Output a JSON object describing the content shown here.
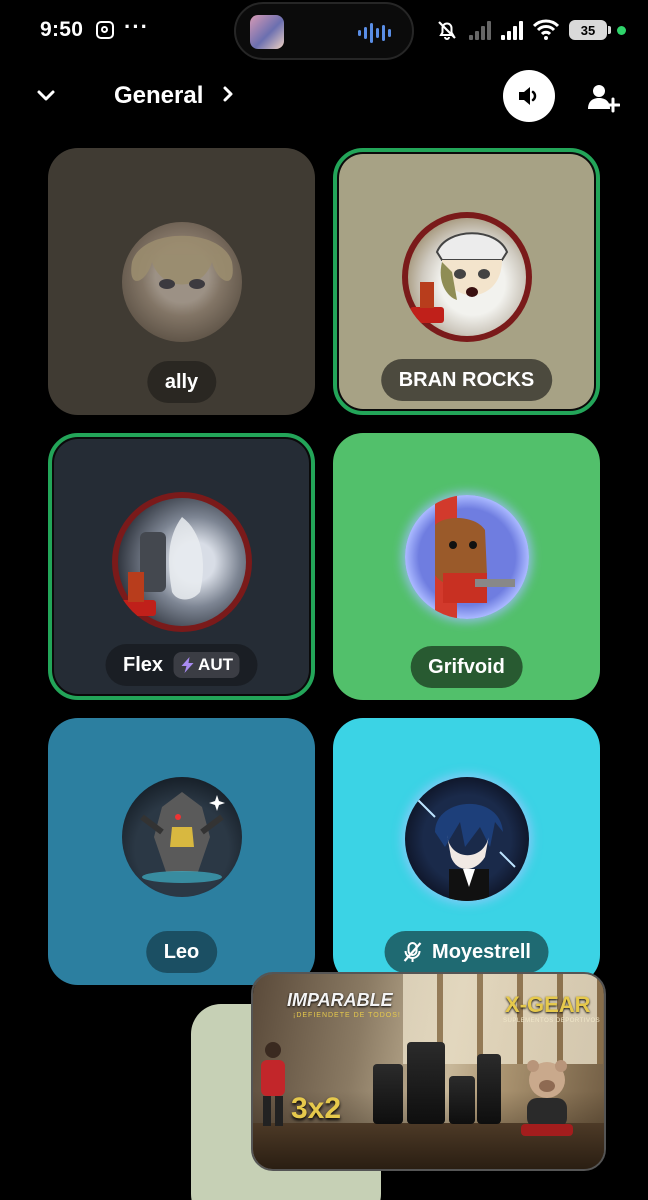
{
  "status_bar": {
    "time": "9:50",
    "overflow": "···",
    "battery": "35",
    "icons": [
      "instagram-icon",
      "audio-wave-icon",
      "muted-bell-icon",
      "signal-icon",
      "wifi-icon",
      "battery-icon"
    ]
  },
  "header": {
    "title": "General",
    "icons": [
      "chevron-down-icon",
      "chevron-right-icon",
      "speaker-icon",
      "add-user-icon"
    ]
  },
  "participants": [
    {
      "name": "ally",
      "speaking": false,
      "tile_color": "#403b33",
      "pill_color": "#2a2722"
    },
    {
      "name": "BRAN ROCKS",
      "speaking": true,
      "tile_color": "#a7a285",
      "pill_color": "#4c4a3e"
    },
    {
      "name": "Flex",
      "tag": "AUT",
      "speaking": true,
      "tile_color": "#252c35",
      "pill_color": "#1a1e24"
    },
    {
      "name": "Grifvoid",
      "speaking": false,
      "tile_color": "#52c06b",
      "pill_color": "#285a31"
    },
    {
      "name": "Leo",
      "speaking": false,
      "tile_color": "#2c7fa0",
      "pill_color": "#1b4f63"
    },
    {
      "name": "Moyestrell",
      "muted": true,
      "speaking": false,
      "tile_color": "#3bd3e5",
      "pill_color": "#1f6a72"
    }
  ],
  "pip_video": {
    "brand_left": "IMPARABLE",
    "brand_left_sub": "¡DEFIENDETE DE TODOS!",
    "brand_right": "X-GEAR",
    "brand_right_sub": "SUPLEMENTOS DEPORTIVOS",
    "promo": "3x2"
  },
  "colors": {
    "speaking_outline": "#23a559",
    "background": "#000000"
  }
}
